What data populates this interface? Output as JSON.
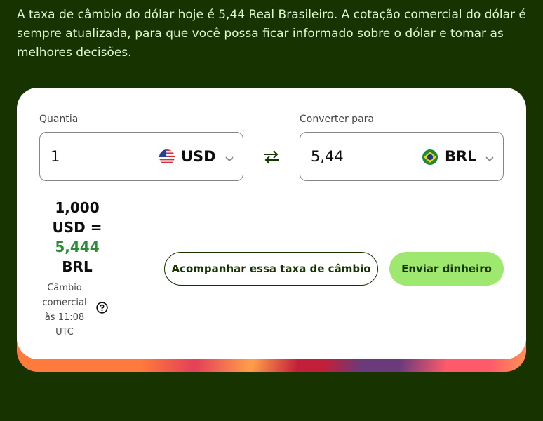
{
  "intro_text": "A taxa de câmbio do dólar hoje é 5,44 Real Brasileiro. A cotação comercial do dólar é sempre atualizada, para que você possa ficar informado sobre o dólar e tomar as melhores decisões.",
  "converter": {
    "amount_label": "Quantia",
    "amount_value": "1",
    "from_currency": "USD",
    "from_flag": "us-flag-icon",
    "convert_to_label": "Converter para",
    "converted_value": "5,44",
    "to_currency": "BRL",
    "to_flag": "brazil-flag-icon"
  },
  "rate": {
    "line1": "1,000",
    "line2": "USD =",
    "line3": "5,444",
    "line4": "BRL",
    "note": "Câmbio comercial às 11:08 UTC"
  },
  "actions": {
    "track_label": "Acompanhar essa taxa de câmbio",
    "send_label": "Enviar dinheiro"
  },
  "colors": {
    "background": "#163300",
    "accent_green": "#9fe870",
    "rate_green": "#2f8a3a"
  }
}
